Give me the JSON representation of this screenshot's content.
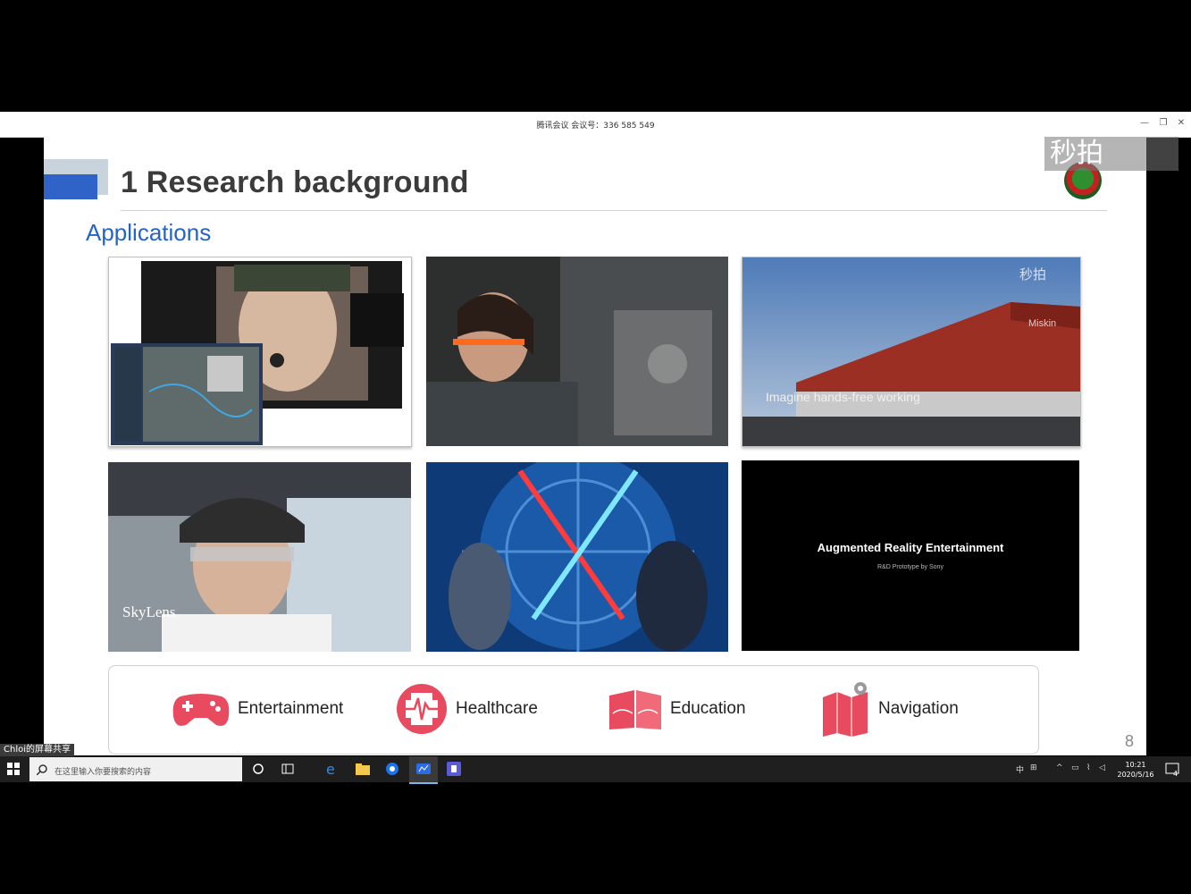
{
  "window": {
    "title": "腾讯会议 会议号：336 585 549"
  },
  "slide": {
    "title": "1 Research background",
    "section": "Applications",
    "watermark": "秒拍",
    "page_number": "8",
    "tiles": {
      "skylens_caption": "SkyLens",
      "warehouse_caption": "Imagine hands-free working",
      "warehouse_watermark": "秒拍",
      "warehouse_sign": "Miskin",
      "sony_title": "Augmented Reality Entertainment",
      "sony_subtitle": "R&D Prototype by Sony"
    },
    "categories": [
      {
        "label": "Entertainment",
        "icon": "gamepad-icon"
      },
      {
        "label": "Healthcare",
        "icon": "medical-cross-icon"
      },
      {
        "label": "Education",
        "icon": "open-book-icon"
      },
      {
        "label": "Navigation",
        "icon": "map-pin-icon"
      }
    ]
  },
  "share_label": "Chloi的屏幕共享",
  "taskbar": {
    "search_placeholder": "在这里输入你要搜索的内容",
    "time": "10:21",
    "date": "2020/5/16",
    "ime": "中",
    "notifications": "4"
  },
  "colors": {
    "accent": "#2463c8",
    "category_icon": "#e84a5f"
  }
}
